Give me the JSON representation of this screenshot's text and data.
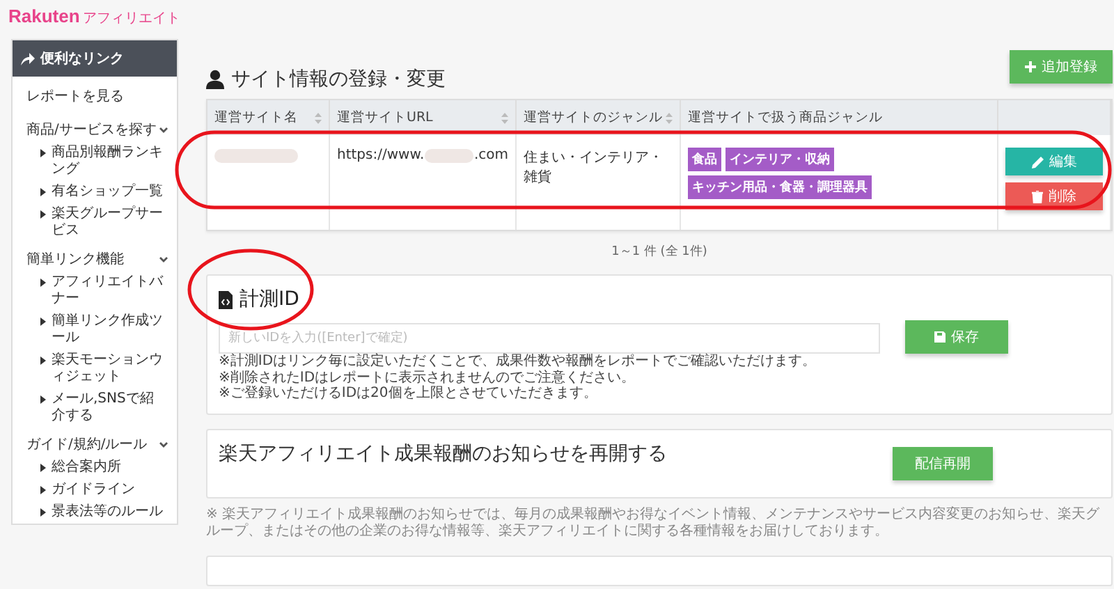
{
  "logo": {
    "brand": "Rakuten",
    "product": "アフィリエイト"
  },
  "sidebar": {
    "header": "便利なリンク",
    "items": [
      {
        "kind": "link",
        "label": "レポートを見る"
      },
      {
        "kind": "group",
        "label": "商品/サービスを探す",
        "expanded": true,
        "children": [
          {
            "label": "商品別報酬ランキング"
          },
          {
            "label": "有名ショップ一覧"
          },
          {
            "label": "楽天グループサービス"
          }
        ]
      },
      {
        "kind": "group",
        "label": "簡単リンク機能",
        "expanded": true,
        "children": [
          {
            "label": "アフィリエイトバナー"
          },
          {
            "label": "簡単リンク作成ツール"
          },
          {
            "label": "楽天モーションウィジェット"
          },
          {
            "label": "メール,SNSで紹介する"
          }
        ]
      },
      {
        "kind": "group",
        "label": "ガイド/規約/ルール",
        "expanded": true,
        "children": [
          {
            "label": "総合案内所"
          },
          {
            "label": "ガイドライン"
          },
          {
            "label": "景表法等のルール"
          }
        ]
      }
    ]
  },
  "site_info": {
    "title": "サイト情報の登録・変更",
    "add_button": "追加登録",
    "columns": [
      {
        "label": "運営サイト名",
        "sortable": true
      },
      {
        "label": "運営サイトURL",
        "sortable": true
      },
      {
        "label": "運営サイトのジャンル",
        "sortable": true
      },
      {
        "label": "運営サイトで扱う商品ジャンル",
        "sortable": false
      }
    ],
    "rows": [
      {
        "url_prefix": "https://www.",
        "url_suffix": ".com",
        "genre": "住まい・インテリア・雑貨",
        "tags": [
          "食品",
          "インテリア・収納",
          "キッチン用品・食器・調理器具"
        ],
        "edit_button": "編集",
        "delete_button": "削除"
      }
    ],
    "pagination": "1～1 件 (全 1件)"
  },
  "tracking_id": {
    "title": "計測ID",
    "placeholder": "新しいIDを入力([Enter]で確定)",
    "save_button": "保存",
    "notes": [
      "※計測IDはリンク毎に設定いただくことで、成果件数や報酬をレポートでご確認いただけます。",
      "※削除されたIDはレポートに表示されませんのでご注意ください。",
      "※ご登録いただけるIDは20個を上限とさせていただきます。"
    ]
  },
  "notification": {
    "title": "楽天アフィリエイト成果報酬のお知らせを再開する",
    "button": "配信再開",
    "note": "※ 楽天アフィリエイト成果報酬のお知らせでは、毎月の成果報酬やお得なイベント情報、メンテナンスやサービス内容変更のお知らせ、楽天グループ、またはその他の企業のお得な情報等、楽天アフィリエイトに関する各種情報をお届けしております。"
  }
}
